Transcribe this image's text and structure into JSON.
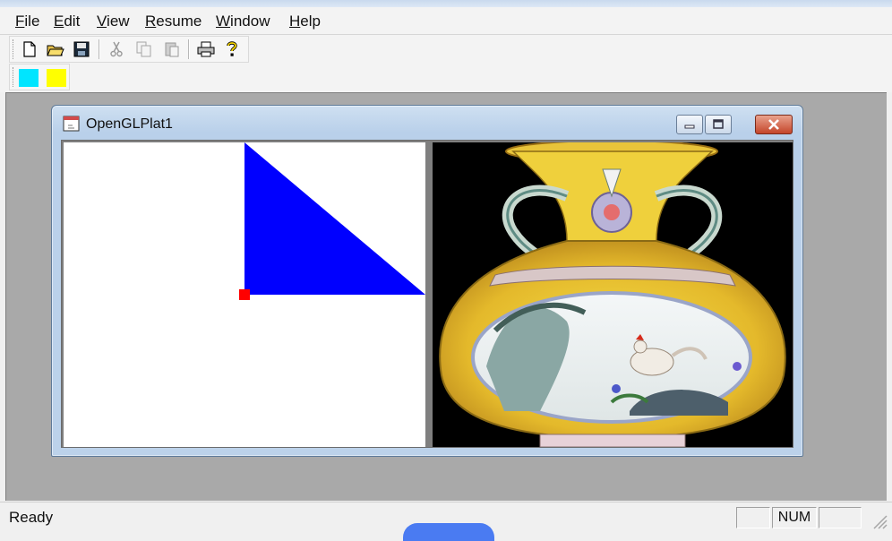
{
  "menu": [
    {
      "label": "File"
    },
    {
      "label": "Edit"
    },
    {
      "label": "View"
    },
    {
      "label": "Resume"
    },
    {
      "label": "Window"
    },
    {
      "label": "Help"
    }
  ],
  "toolbar": {
    "buttons": [
      {
        "icon": "new-document-icon"
      },
      {
        "icon": "open-folder-icon"
      },
      {
        "icon": "save-disk-icon"
      },
      {
        "icon": "cut-icon"
      },
      {
        "icon": "copy-icon"
      },
      {
        "icon": "paste-icon"
      },
      {
        "icon": "print-icon"
      },
      {
        "icon": "help-question-icon"
      }
    ]
  },
  "color_toolbar": {
    "swatches": [
      {
        "name": "cyan",
        "color": "#00e5ff"
      },
      {
        "name": "yellow",
        "color": "#ffff00"
      }
    ]
  },
  "child_window": {
    "title": "OpenGLPlat1",
    "left_view": {
      "background": "#ffffff",
      "triangle_color": "#0000ff",
      "marker_color": "#ff0000"
    },
    "right_view": {
      "content": "textured image of a porcelain vase",
      "background": "#000000"
    }
  },
  "statusbar": {
    "text": "Ready",
    "panes": [
      "",
      "NUM",
      ""
    ]
  }
}
